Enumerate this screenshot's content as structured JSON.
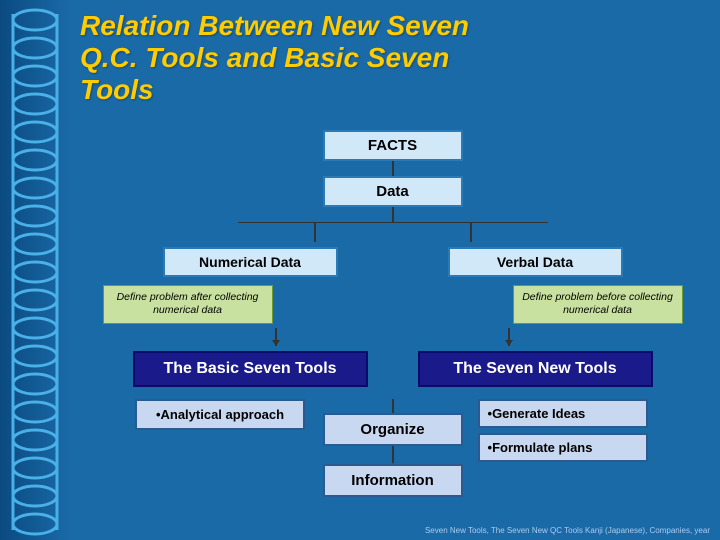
{
  "title": {
    "line1": "Relation Between New Seven",
    "line2": "Q.C. Tools and Basic Seven",
    "line3": "Tools"
  },
  "diagram": {
    "facts": "FACTS",
    "data": "Data",
    "numerical_data": "Numerical Data",
    "verbal_data": "Verbal Data",
    "define_left": "Define problem after collecting numerical data",
    "define_right": "Define problem before collecting numerical data",
    "basic_seven": "The Basic Seven Tools",
    "seven_new": "The Seven New Tools",
    "analytical": "Analytical approach",
    "generate": "Generate Ideas",
    "formulate": "Formulate plans",
    "organize": "Organize",
    "information": "Information"
  },
  "footer": "Seven New Tools, The Seven New QC Tools Kanji (Japanese), Companies, year"
}
